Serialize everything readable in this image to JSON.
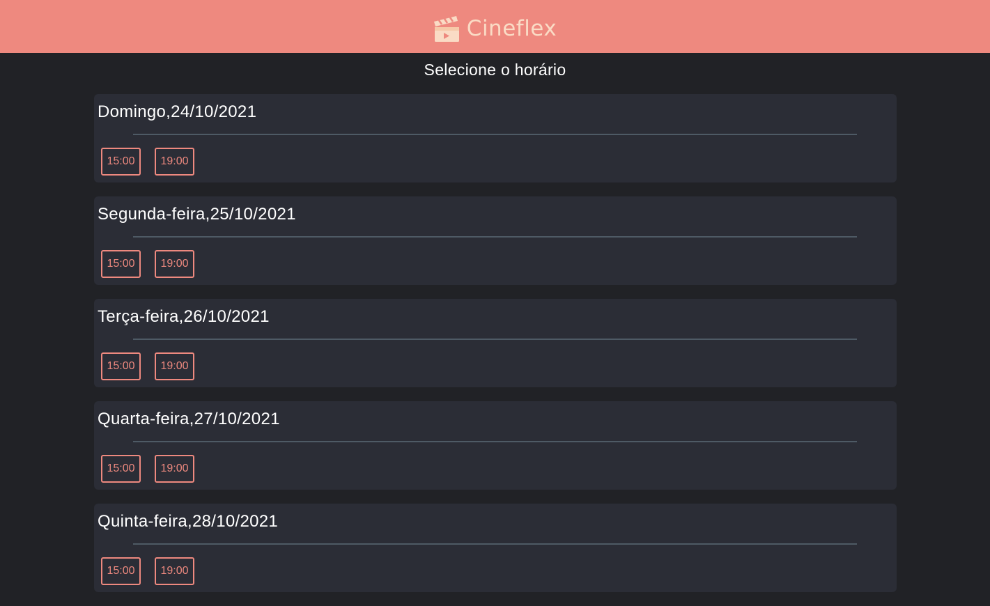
{
  "header": {
    "logo_text": "Cineflex",
    "logo_icon": "clapperboard-icon",
    "colors": {
      "background": "#EE897F",
      "logo": "#FADBC5"
    }
  },
  "page": {
    "title": "Selecione o horário",
    "colors": {
      "background": "#212226",
      "card": "#2B2D36",
      "accent": "#EE897F"
    }
  },
  "sessions": [
    {
      "day": "Domingo,24/10/2021",
      "times": [
        "15:00",
        "19:00"
      ]
    },
    {
      "day": "Segunda-feira,25/10/2021",
      "times": [
        "15:00",
        "19:00"
      ]
    },
    {
      "day": "Terça-feira,26/10/2021",
      "times": [
        "15:00",
        "19:00"
      ]
    },
    {
      "day": "Quarta-feira,27/10/2021",
      "times": [
        "15:00",
        "19:00"
      ]
    },
    {
      "day": "Quinta-feira,28/10/2021",
      "times": [
        "15:00",
        "19:00"
      ]
    }
  ]
}
